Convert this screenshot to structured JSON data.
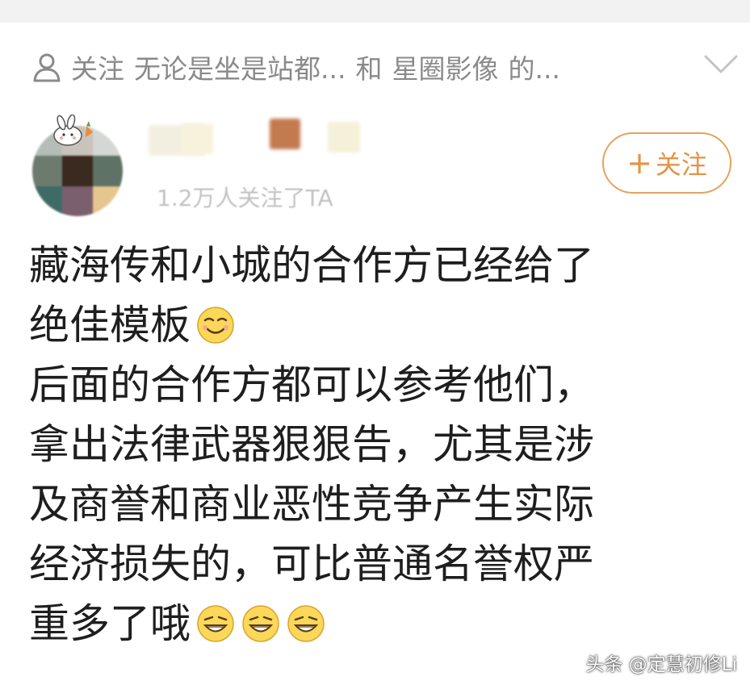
{
  "context": {
    "follow_label": "关注",
    "topic": "无论是坐是站都...",
    "conjunction": "和",
    "account": "星圈影像",
    "suffix": "的..."
  },
  "author": {
    "followers_text": "1.2万人关注了TA",
    "follow_button_label": "关注"
  },
  "post": {
    "lines": [
      "藏海传和小城的合作方已经给了",
      "绝佳模板",
      "后面的合作方都可以参考他们，",
      "拿出法律武器狠狠告，尤其是涉",
      "及商誉和商业恶性竞争产生实际",
      "经济损失的，可比普通名誉权严",
      "重多了哦"
    ],
    "emoji_after_line_2": "smile-emoji",
    "emoji_after_line_7": [
      "grin-emoji",
      "grin-emoji",
      "grin-emoji"
    ]
  },
  "watermark": "头条 @定慧初修Li",
  "colors": {
    "accent": "#e59345",
    "muted_text": "#8a8a8a",
    "top_bar": "#f2f2f2"
  }
}
